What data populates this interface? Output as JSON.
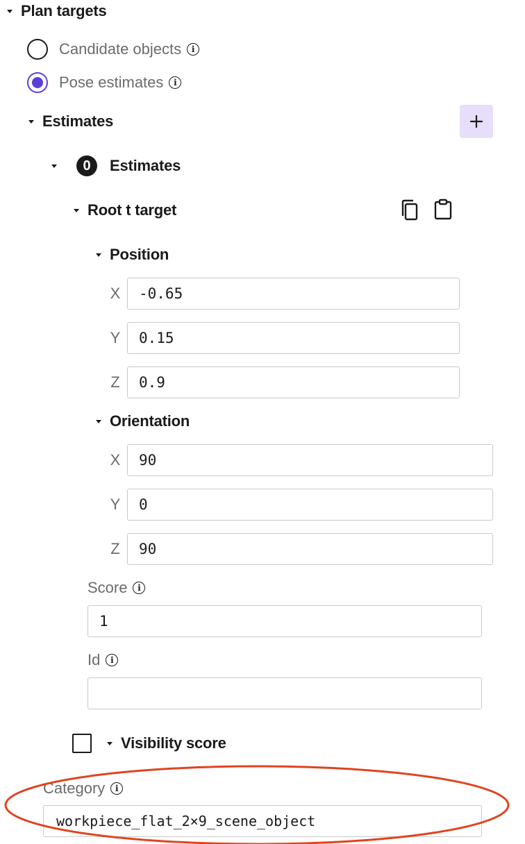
{
  "plan_targets": {
    "title": "Plan targets",
    "options": [
      {
        "label": "Candidate objects",
        "selected": false
      },
      {
        "label": "Pose estimates",
        "selected": true
      }
    ]
  },
  "estimates": {
    "title": "Estimates",
    "add_icon": "plus-icon",
    "item": {
      "index_badge": "0",
      "title": "Estimates",
      "root_target": {
        "title": "Root t target",
        "copy_icon": "copy-icon",
        "paste_icon": "clipboard-icon",
        "position": {
          "title": "Position",
          "x_label": "X",
          "x": "-0.65",
          "y_label": "Y",
          "y": "0.15",
          "z_label": "Z",
          "z": "0.9"
        },
        "orientation": {
          "title": "Orientation",
          "x_label": "X",
          "x": "90",
          "y_label": "Y",
          "y": "0",
          "z_label": "Z",
          "z": "90"
        }
      },
      "score": {
        "label": "Score",
        "value": "1"
      },
      "id": {
        "label": "Id",
        "value": ""
      },
      "visibility_score": {
        "label": "Visibility score",
        "enabled": false
      }
    }
  },
  "category": {
    "label": "Category",
    "value": "workpiece_flat_2×9_scene_object"
  },
  "colors": {
    "accent": "#5b3fd9",
    "accent_bg": "#e6defa",
    "annotation": "#e0441f"
  }
}
